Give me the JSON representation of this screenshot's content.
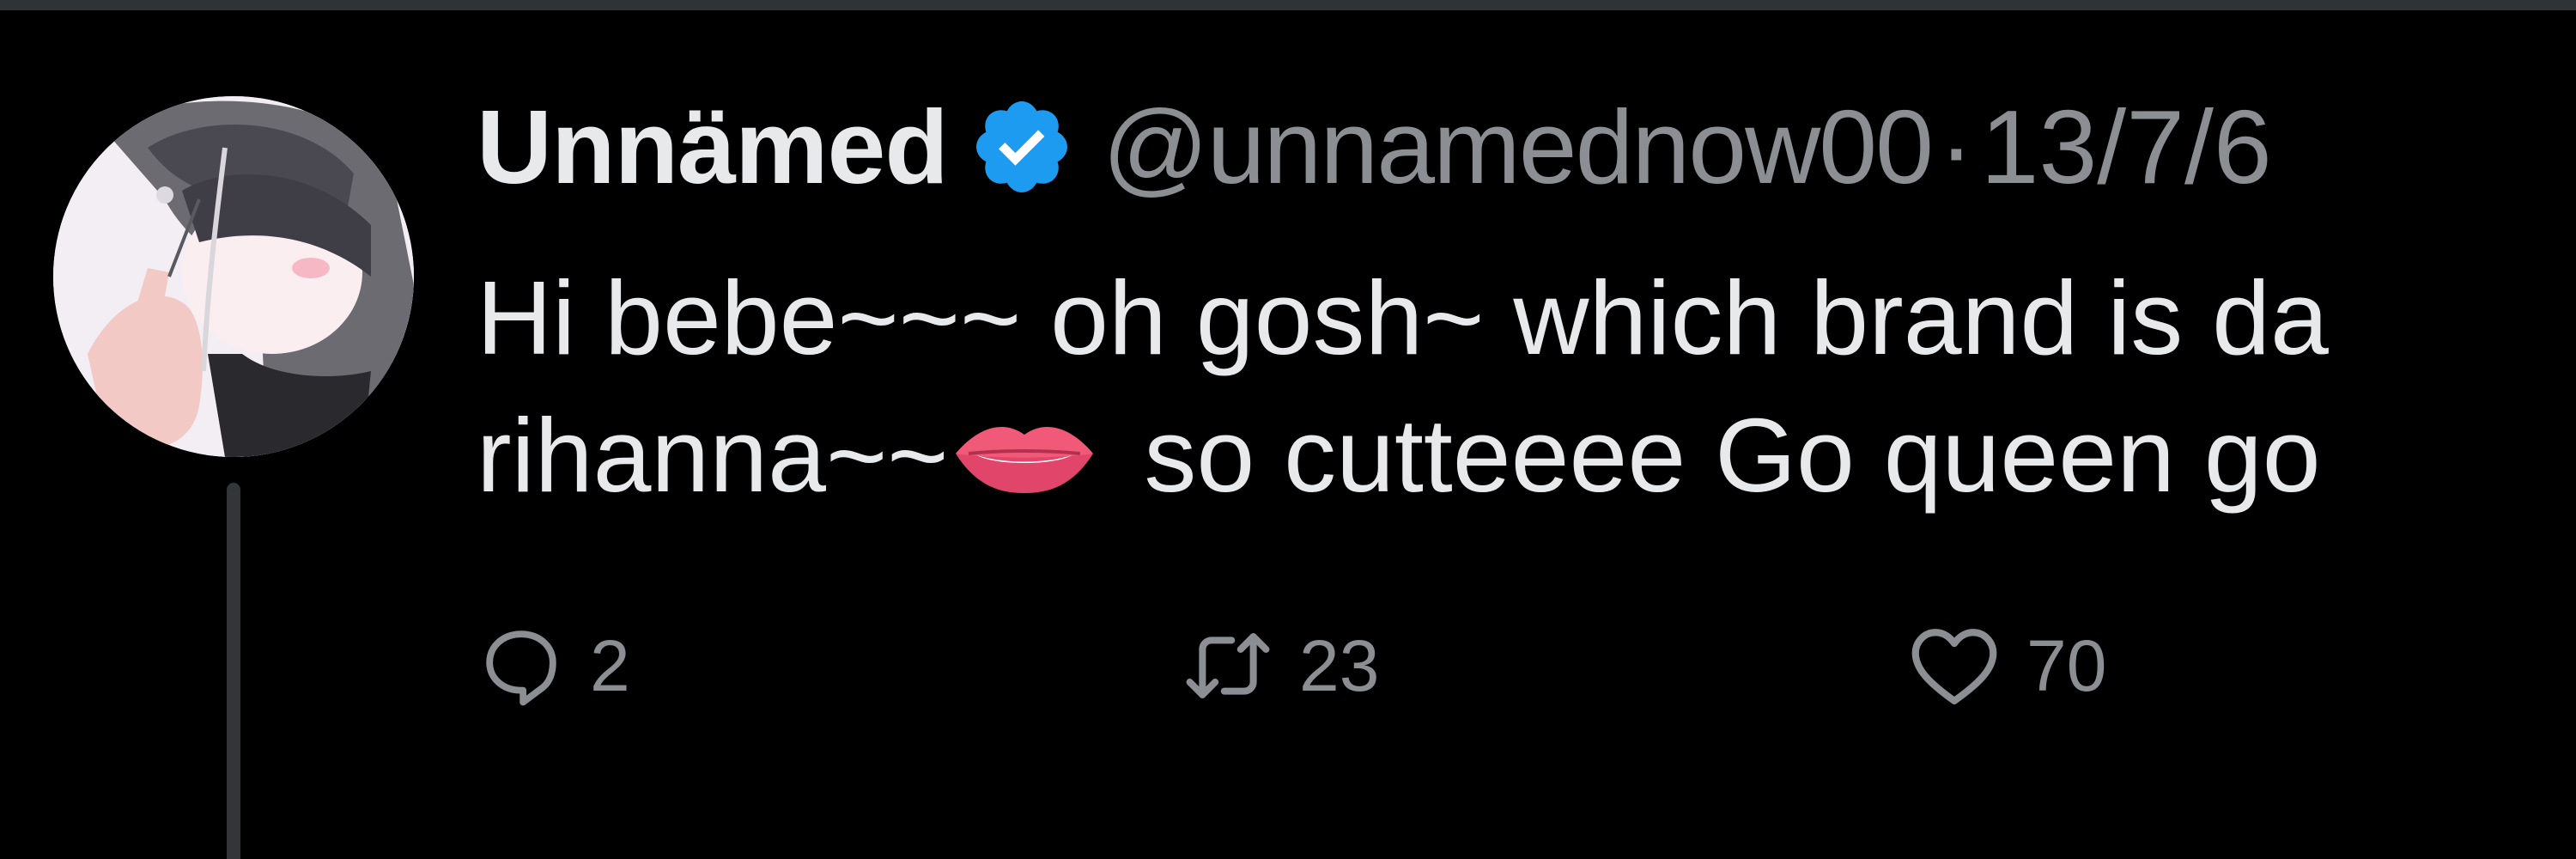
{
  "tweet": {
    "author": {
      "display_name": "Unnämed",
      "verified_icon": "verified-badge-icon",
      "handle": "@unnamednow00",
      "separator": "·",
      "date": "13/7/6"
    },
    "text_lines": [
      "Hi bebe~~~ oh gosh~ which brand is da",
      "rihanna~~",
      " so cutteeee Go queen go"
    ],
    "emoji": "lips-biting-emoji",
    "actions": {
      "reply": {
        "icon": "reply-icon",
        "count": "2"
      },
      "retweet": {
        "icon": "retweet-icon",
        "count": "23"
      },
      "like": {
        "icon": "heart-icon",
        "count": "70"
      }
    }
  },
  "colors": {
    "background": "#000000",
    "text_primary": "#e7e9ea",
    "text_secondary": "#8b8f93",
    "verified": "#1d9bf0",
    "thread_line": "#333639"
  }
}
